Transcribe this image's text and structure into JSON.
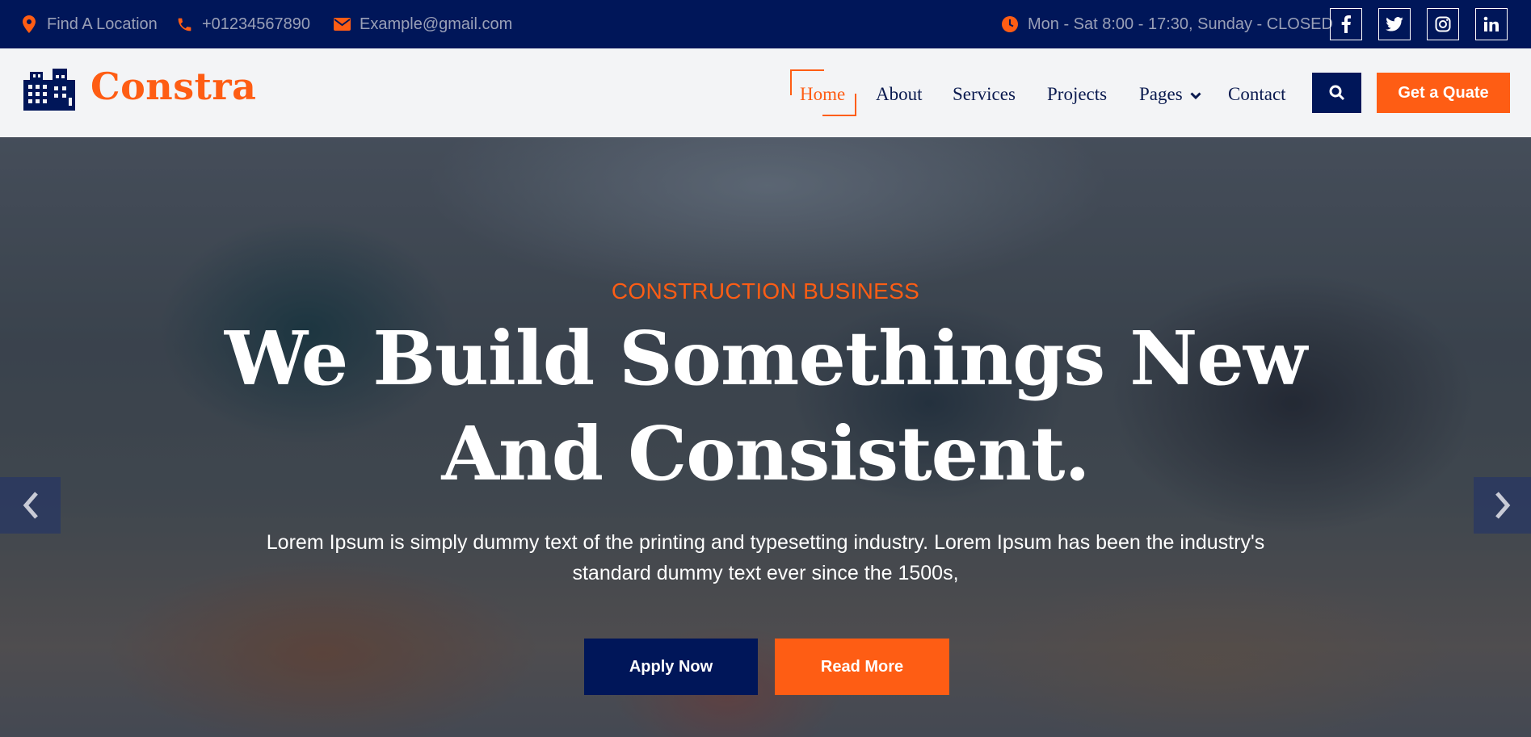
{
  "topbar": {
    "location": "Find A Location",
    "phone": "+01234567890",
    "email": "Example@gmail.com",
    "hours": "Mon - Sat 8:00 - 17:30, Sunday - CLOSED",
    "social_icons": [
      "facebook-icon",
      "twitter-icon",
      "instagram-icon",
      "linkedin-icon"
    ]
  },
  "brand": {
    "name": "Constra",
    "logo_icon": "building-icon"
  },
  "nav": {
    "items": [
      {
        "label": "Home",
        "active": true
      },
      {
        "label": "About"
      },
      {
        "label": "Services"
      },
      {
        "label": "Projects"
      },
      {
        "label": "Pages",
        "has_dropdown": true
      },
      {
        "label": "Contact"
      }
    ],
    "search_icon": "search-icon",
    "cta_label": "Get a Quate"
  },
  "hero": {
    "subtitle": "CONSTRUCTION BUSINESS",
    "title_line1": "We Build Somethings New",
    "title_line2": "And Consistent.",
    "text_line1": "Lorem Ipsum is simply dummy text of the printing and typesetting industry. Lorem Ipsum has been the industry's",
    "text_line2": "standard dummy text ever since the 1500s,",
    "primary_button": "Apply Now",
    "secondary_button": "Read More",
    "prev_icon": "chevron-left-icon",
    "next_icon": "chevron-right-icon"
  },
  "colors": {
    "navy": "#001659",
    "orange": "#fe5d14",
    "nav_bg": "#f3f4f6"
  }
}
